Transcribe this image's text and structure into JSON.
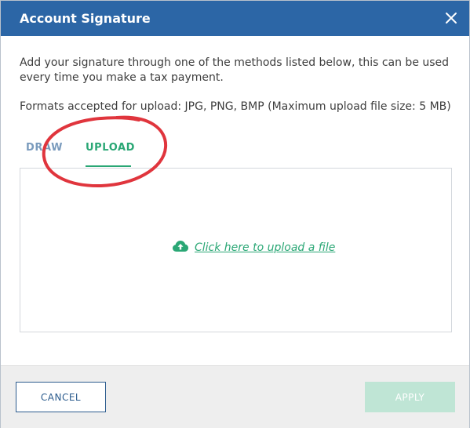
{
  "dialog": {
    "title": "Account Signature",
    "close_icon": "close-icon"
  },
  "content": {
    "description": "Add your signature through one of the methods listed below, this can be used every time you make a tax payment.",
    "formats": "Formats accepted for upload: JPG, PNG, BMP (Maximum upload file size: 5 MB)"
  },
  "tabs": [
    {
      "label": "DRAW",
      "active": false
    },
    {
      "label": "UPLOAD",
      "active": true
    }
  ],
  "upload": {
    "icon": "cloud-upload-icon",
    "link_text": "Click here to upload a file"
  },
  "footer": {
    "cancel_label": "CANCEL",
    "apply_label": "APPLY",
    "apply_enabled": false
  },
  "colors": {
    "header": "#2c66a6",
    "accent_green": "#2aa775",
    "annotation_red": "#e0353d"
  }
}
